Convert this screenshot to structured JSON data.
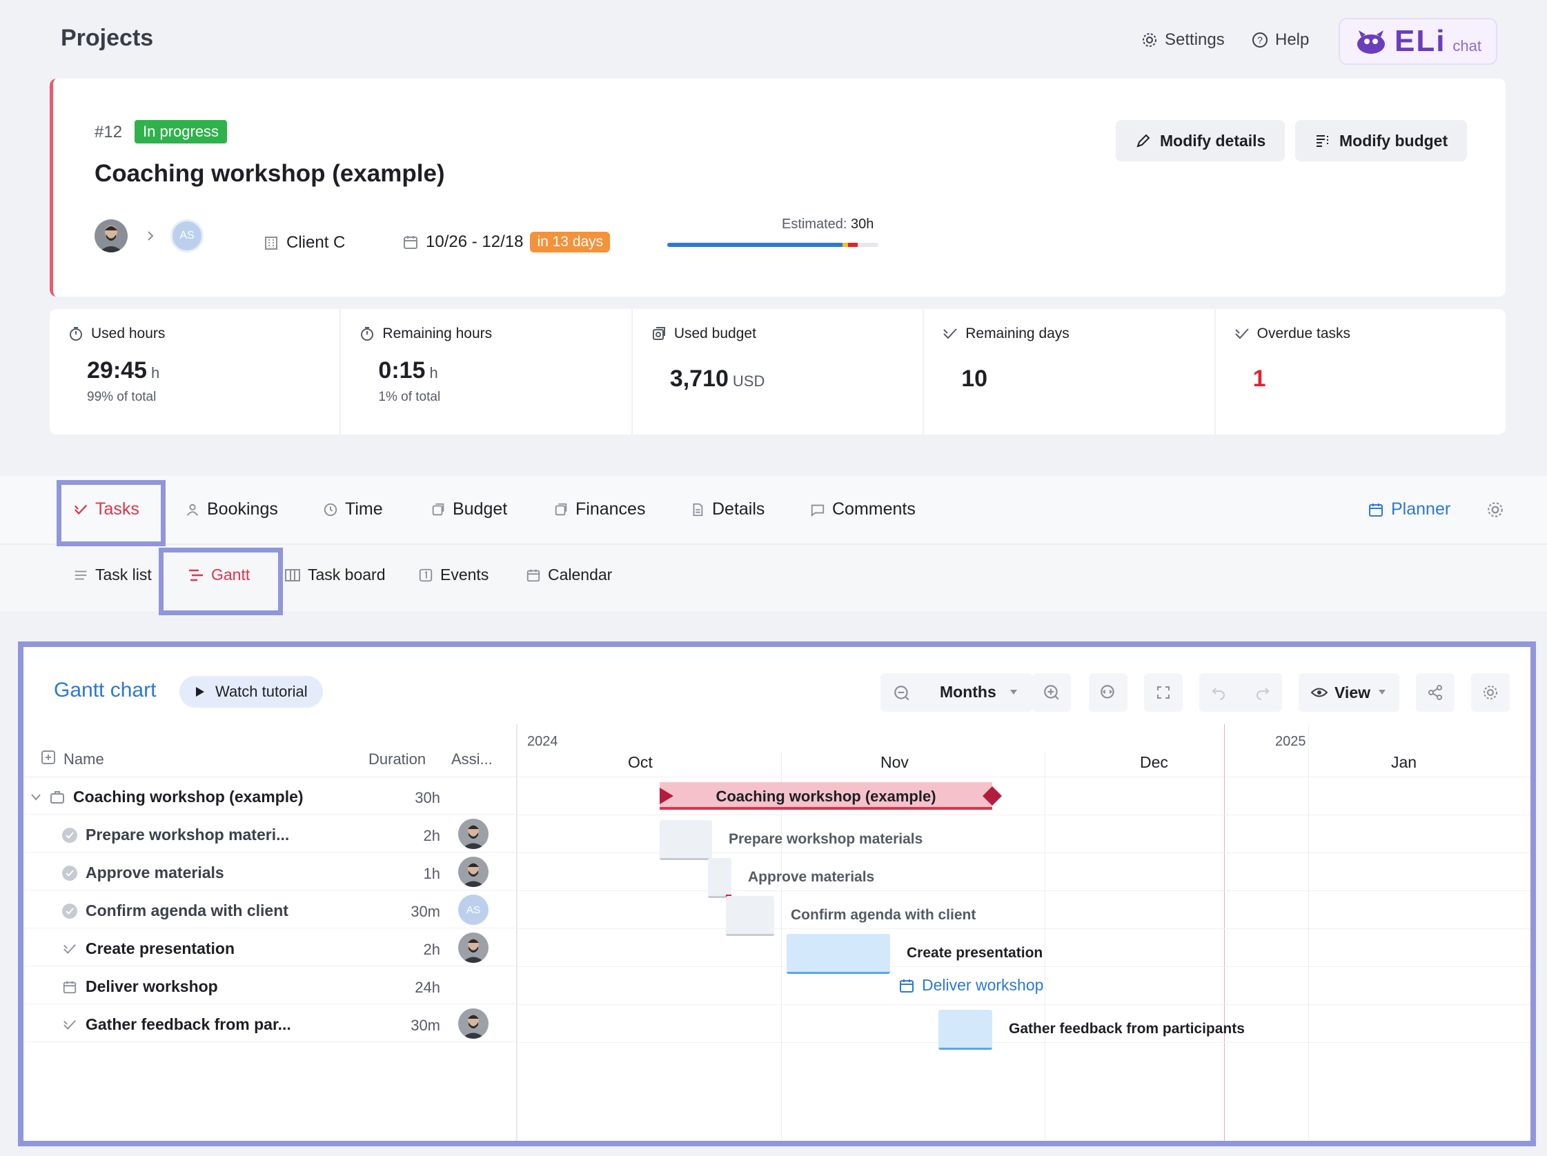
{
  "header": {
    "title": "Projects",
    "settings_label": "Settings",
    "help_label": "Help",
    "eli_logo": "ELi",
    "eli_chat": "chat"
  },
  "project": {
    "number": "#12",
    "status": "In progress",
    "title": "Coaching workshop (example)",
    "owner_initials": "AS",
    "client": "Client C",
    "date_range": "10/26 - 12/18",
    "due_badge": "in 13 days",
    "estimated_label": "Estimated:",
    "estimated_value": "30h",
    "estimate_progress": 0.9,
    "modify_details": "Modify details",
    "modify_budget": "Modify budget"
  },
  "stats": [
    {
      "label": "Used hours",
      "value": "29:45",
      "unit": "h",
      "sub": "99% of total",
      "icon": "stopwatch-icon"
    },
    {
      "label": "Remaining hours",
      "value": "0:15",
      "unit": "h",
      "sub": "1% of total",
      "icon": "stopwatch-icon"
    },
    {
      "label": "Used budget",
      "value": "3,710",
      "unit": "USD",
      "sub": "",
      "icon": "money-icon"
    },
    {
      "label": "Remaining days",
      "value": "10",
      "unit": "",
      "sub": "",
      "icon": "check-icon"
    },
    {
      "label": "Overdue tasks",
      "value": "1",
      "unit": "",
      "sub": "",
      "icon": "check-icon",
      "value_color": "#e0232f"
    }
  ],
  "tabs": {
    "items": [
      "Tasks",
      "Bookings",
      "Time",
      "Budget",
      "Finances",
      "Details",
      "Comments"
    ],
    "planner": "Planner",
    "active": "Tasks"
  },
  "subtabs": {
    "items": [
      "Task list",
      "Gantt",
      "Task board",
      "Events",
      "Calendar"
    ],
    "active": "Gantt"
  },
  "gantt": {
    "title": "Gantt chart",
    "watch_tutorial": "Watch tutorial",
    "scale": "Months",
    "view": "View",
    "columns": {
      "name": "Name",
      "duration": "Duration",
      "assignee": "Assi..."
    },
    "years": [
      "2024",
      "2025"
    ],
    "months": [
      "Oct",
      "Nov",
      "Dec",
      "Jan"
    ],
    "rows": [
      {
        "name": "Coaching workshop (example)",
        "duration": "30h",
        "type": "project",
        "bar_label": "Coaching workshop (example)",
        "assignee": ""
      },
      {
        "name": "Prepare workshop materi...",
        "duration": "2h",
        "type": "done",
        "bar_label": "Prepare workshop materials",
        "assignee": "photo"
      },
      {
        "name": "Approve materials",
        "duration": "1h",
        "type": "done",
        "bar_label": "Approve materials",
        "assignee": "photo"
      },
      {
        "name": "Confirm agenda with client",
        "duration": "30m",
        "type": "done",
        "bar_label": "Confirm agenda with client",
        "assignee": "AS"
      },
      {
        "name": "Create presentation",
        "duration": "2h",
        "type": "todo",
        "bar_label": "Create presentation",
        "assignee": "photo"
      },
      {
        "name": "Deliver workshop",
        "duration": "24h",
        "type": "event",
        "bar_label": "Deliver workshop",
        "assignee": ""
      },
      {
        "name": "Gather feedback from par...",
        "duration": "30m",
        "type": "todo",
        "bar_label": "Gather feedback from participants",
        "assignee": "photo"
      }
    ]
  },
  "colors": {
    "accent_blue": "#2b78d6",
    "active_red": "#e0334c",
    "status_green": "#2fb24b",
    "due_orange": "#f4923a",
    "highlight": "#8f96dc",
    "project_bar": "#f5c2cc",
    "project_bar_edge": "#b21d3e"
  }
}
